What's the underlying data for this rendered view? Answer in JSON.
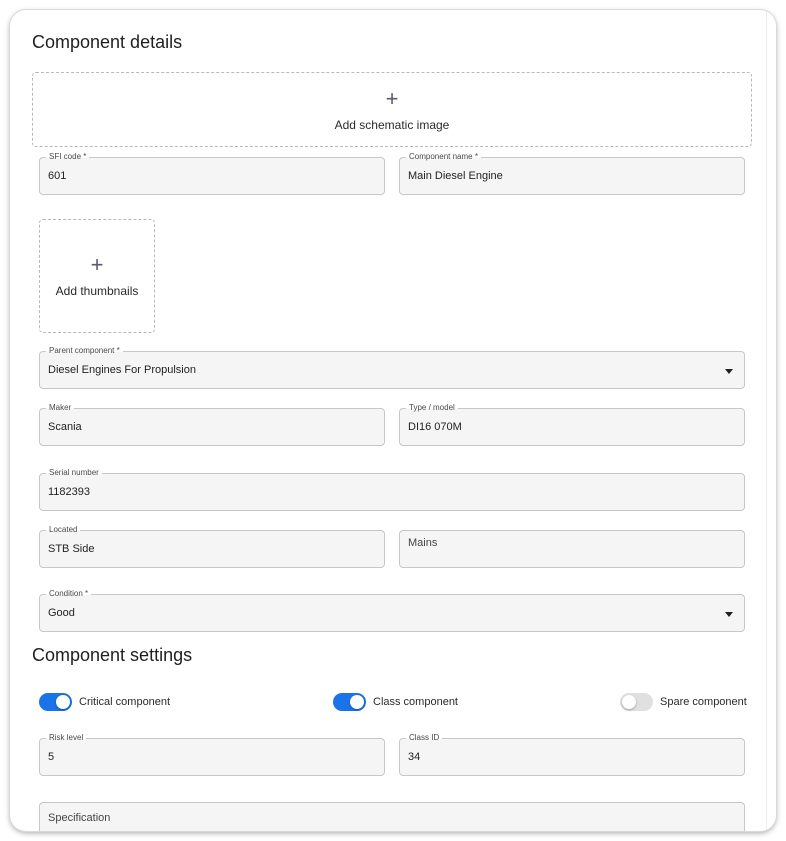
{
  "details": {
    "title": "Component details",
    "schematic_label": "Add schematic image",
    "thumbnails_label": "Add thumbnails",
    "sfi_code": {
      "label": "SFI code *",
      "value": "601"
    },
    "component_name": {
      "label": "Component name *",
      "value": "Main Diesel Engine"
    },
    "parent_component": {
      "label": "Parent component *",
      "value": "Diesel Engines For Propulsion"
    },
    "maker": {
      "label": "Maker",
      "value": "Scania"
    },
    "type_model": {
      "label": "Type / model",
      "value": "DI16 070M"
    },
    "serial_number": {
      "label": "Serial number",
      "value": "1182393"
    },
    "located": {
      "label": "Located",
      "value": "STB Side"
    },
    "mains": {
      "placeholder": "Mains"
    },
    "condition": {
      "label": "Condition *",
      "value": "Good"
    }
  },
  "settings": {
    "title": "Component settings",
    "toggles": {
      "critical": {
        "label": "Critical component",
        "on": true
      },
      "class": {
        "label": "Class component",
        "on": true
      },
      "spare": {
        "label": "Spare component",
        "on": false
      }
    },
    "risk_level": {
      "label": "Risk level",
      "value": "5"
    },
    "class_id": {
      "label": "Class ID",
      "value": "34"
    },
    "specification": {
      "placeholder": "Specification"
    }
  },
  "icons": {
    "plus": "+",
    "dropdown": "caret-down-icon"
  },
  "colors": {
    "accent": "#1a73e8",
    "field_bg": "#f5f5f5",
    "toggle_off": "#e0e0e0"
  }
}
